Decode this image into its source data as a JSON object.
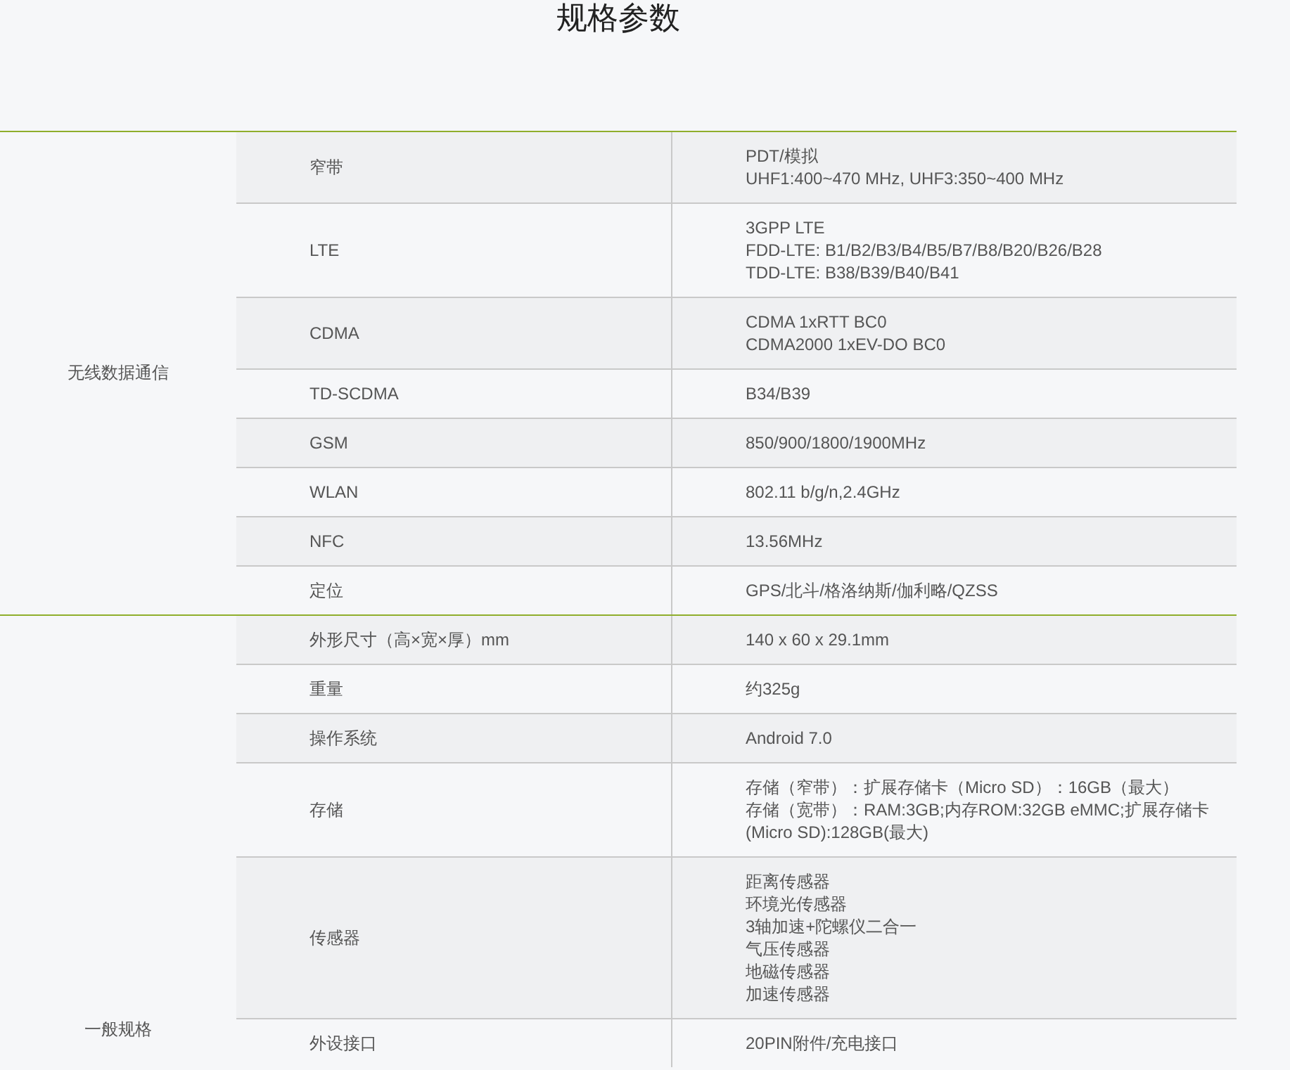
{
  "title": "规格参数",
  "groups": [
    {
      "label": "无线数据通信",
      "rows": [
        {
          "name": "窄带",
          "values": [
            "PDT/模拟",
            "UHF1:400~470 MHz, UHF3:350~400 MHz"
          ]
        },
        {
          "name": "LTE",
          "values": [
            "3GPP LTE",
            "FDD-LTE: B1/B2/B3/B4/B5/B7/B8/B20/B26/B28",
            "TDD-LTE: B38/B39/B40/B41"
          ]
        },
        {
          "name": "CDMA",
          "values": [
            "CDMA 1xRTT BC0",
            "CDMA2000 1xEV-DO BC0"
          ]
        },
        {
          "name": "TD-SCDMA",
          "values": [
            "B34/B39"
          ]
        },
        {
          "name": "GSM",
          "values": [
            "850/900/1800/1900MHz"
          ]
        },
        {
          "name": "WLAN",
          "values": [
            "802.11 b/g/n,2.4GHz"
          ]
        },
        {
          "name": "NFC",
          "values": [
            "13.56MHz"
          ]
        },
        {
          "name": "定位",
          "values": [
            "GPS/北斗/格洛纳斯/伽利略/QZSS"
          ]
        }
      ]
    },
    {
      "label": "一般规格",
      "rows": [
        {
          "name": "外形尺寸（高×宽×厚）mm",
          "values": [
            "140 x 60 x 29.1mm"
          ]
        },
        {
          "name": "重量",
          "values": [
            "约325g"
          ]
        },
        {
          "name": "操作系统",
          "values": [
            "Android 7.0"
          ]
        },
        {
          "name": "存储",
          "values": [
            "存储（窄带）：扩展存储卡（Micro SD）：16GB（最大）",
            "存储（宽带）：RAM:3GB;内存ROM:32GB eMMC;扩展存储卡(Micro SD):128GB(最大)"
          ]
        },
        {
          "name": "传感器",
          "values": [
            "距离传感器",
            "环境光传感器",
            "3轴加速+陀螺仪二合一",
            "气压传感器",
            "地磁传感器",
            "加速传感器"
          ]
        },
        {
          "name": "外设接口",
          "values": [
            "20PIN附件/充电接口"
          ]
        }
      ]
    }
  ]
}
